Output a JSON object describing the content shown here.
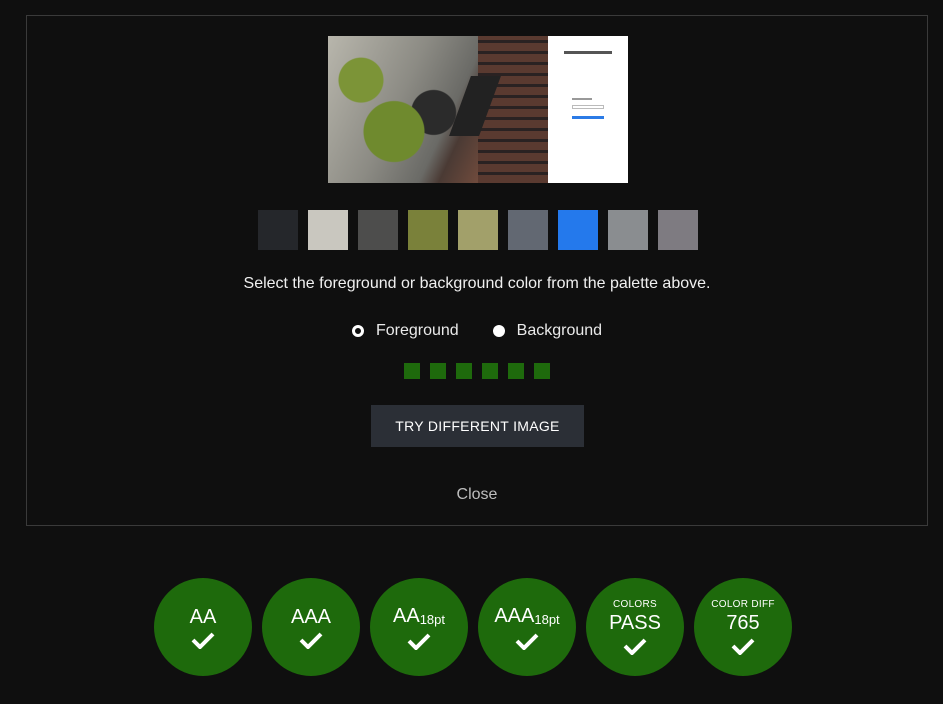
{
  "swatches": [
    "#25272b",
    "#c9c7bf",
    "#4d4d4c",
    "#7a813a",
    "#a2a06a",
    "#626872",
    "#2479ec",
    "#8a8d90",
    "#7e7b81"
  ],
  "instruction": "Select the foreground or background color from the palette above.",
  "radios": {
    "foreground_label": "Foreground",
    "background_label": "Background",
    "selected": "Foreground"
  },
  "mini_squares": [
    "#1e6a0c",
    "#1e6a0c",
    "#1e6a0c",
    "#1e6a0c",
    "#1e6a0c",
    "#1e6a0c"
  ],
  "try_button_label": "TRY DIFFERENT IMAGE",
  "close_label": "Close",
  "results": [
    {
      "main": "AA",
      "sub": "",
      "small": "",
      "status": "pass"
    },
    {
      "main": "AAA",
      "sub": "",
      "small": "",
      "status": "pass"
    },
    {
      "main": "AA",
      "sub": "18pt",
      "small": "",
      "status": "pass"
    },
    {
      "main": "AAA",
      "sub": "18pt",
      "small": "",
      "status": "pass"
    },
    {
      "main": "PASS",
      "sub": "",
      "small": "COLORS",
      "status": "pass"
    },
    {
      "main": "765",
      "sub": "",
      "small": "COLOR DIFF",
      "status": "pass"
    }
  ],
  "badge_color": "#1e6a0c"
}
